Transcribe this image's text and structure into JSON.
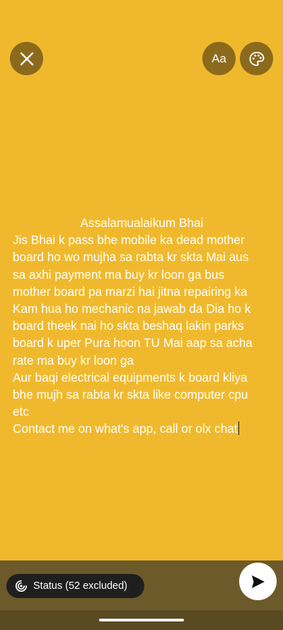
{
  "header": {
    "close_icon": "close-icon",
    "font_label": "Aa",
    "palette_icon": "palette-icon"
  },
  "composer": {
    "text": "                    Assalamualaikum Bhai\nJis Bhai k pass bhe mobile ka dead mother board ho wo mujha sa rabta kr skta Mai aus sa axhi payment ma buy kr loon ga bus mother board pa marzi hai jitna repairing ka Kam hua ho mechanic na jawab da Dia ho k board theek nai ho skta beshaq lakin parks board k uper Pura hoon TU Mai aap sa acha rate ma buy kr loon ga\nAur baqi electrical equipments k board kliya bhe mujh sa rabta kr skta like computer cpu etc\nContact me on what's app, call or olx chat"
  },
  "footer": {
    "audience_label": "Status (52 excluded)",
    "audience_icon": "status-privacy-icon",
    "send_icon": "send-icon"
  },
  "colors": {
    "background": "#F0B92D",
    "button": "#8B6A1C",
    "bottom_bar": "#6D5A2A",
    "pill": "#1F1F1F"
  }
}
